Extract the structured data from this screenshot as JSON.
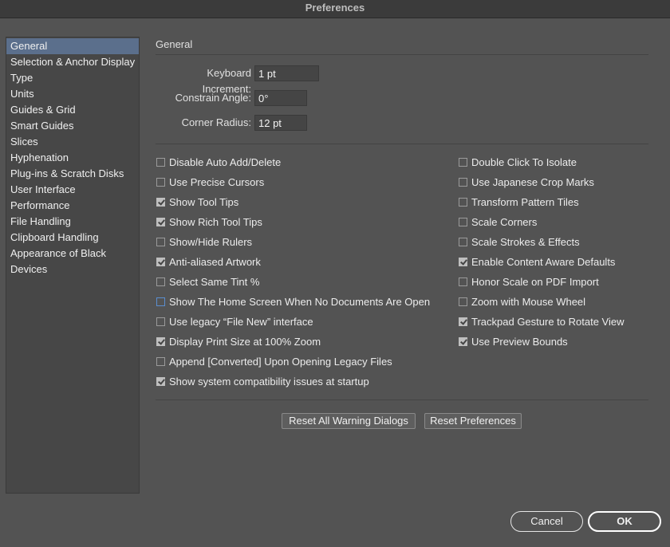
{
  "window": {
    "title": "Preferences"
  },
  "sidebar": {
    "items": [
      {
        "label": "General",
        "selected": true
      },
      {
        "label": "Selection & Anchor Display",
        "selected": false
      },
      {
        "label": "Type",
        "selected": false
      },
      {
        "label": "Units",
        "selected": false
      },
      {
        "label": "Guides & Grid",
        "selected": false
      },
      {
        "label": "Smart Guides",
        "selected": false
      },
      {
        "label": "Slices",
        "selected": false
      },
      {
        "label": "Hyphenation",
        "selected": false
      },
      {
        "label": "Plug-ins & Scratch Disks",
        "selected": false
      },
      {
        "label": "User Interface",
        "selected": false
      },
      {
        "label": "Performance",
        "selected": false
      },
      {
        "label": "File Handling",
        "selected": false
      },
      {
        "label": "Clipboard Handling",
        "selected": false
      },
      {
        "label": "Appearance of Black",
        "selected": false
      },
      {
        "label": "Devices",
        "selected": false
      }
    ]
  },
  "main": {
    "section_title": "General",
    "fields": {
      "keyboard_increment": {
        "label": "Keyboard Increment:",
        "value": "1 pt"
      },
      "constrain_angle": {
        "label": "Constrain Angle:",
        "value": "0°"
      },
      "corner_radius": {
        "label": "Corner Radius:",
        "value": "12 pt"
      }
    },
    "options_left": [
      {
        "label": "Disable Auto Add/Delete",
        "checked": false
      },
      {
        "label": "Use Precise Cursors",
        "checked": false
      },
      {
        "label": "Show Tool Tips",
        "checked": true
      },
      {
        "label": "Show Rich Tool Tips",
        "checked": true
      },
      {
        "label": "Show/Hide Rulers",
        "checked": false
      },
      {
        "label": "Anti-aliased Artwork",
        "checked": true
      },
      {
        "label": "Select Same Tint %",
        "checked": false
      },
      {
        "label": "Show The Home Screen When No Documents Are Open",
        "checked": false,
        "focused": true
      },
      {
        "label": "Use legacy “File New” interface",
        "checked": false
      },
      {
        "label": "Display Print Size at 100% Zoom",
        "checked": true
      },
      {
        "label": "Append [Converted] Upon Opening Legacy Files",
        "checked": false
      },
      {
        "label": "Show system compatibility issues at startup",
        "checked": true
      }
    ],
    "options_right": [
      {
        "label": "Double Click To Isolate",
        "checked": false
      },
      {
        "label": "Use Japanese Crop Marks",
        "checked": false
      },
      {
        "label": "Transform Pattern Tiles",
        "checked": false
      },
      {
        "label": "Scale Corners",
        "checked": false
      },
      {
        "label": "Scale Strokes & Effects",
        "checked": false
      },
      {
        "label": "Enable Content Aware Defaults",
        "checked": true
      },
      {
        "label": "Honor Scale on PDF Import",
        "checked": false
      },
      {
        "label": "Zoom with Mouse Wheel",
        "checked": false
      },
      {
        "label": "Trackpad Gesture to Rotate View",
        "checked": true
      },
      {
        "label": "Use Preview Bounds",
        "checked": true
      }
    ],
    "buttons": {
      "reset_warnings": "Reset All Warning Dialogs",
      "reset_preferences": "Reset Preferences"
    }
  },
  "footer": {
    "cancel": "Cancel",
    "ok": "OK"
  }
}
